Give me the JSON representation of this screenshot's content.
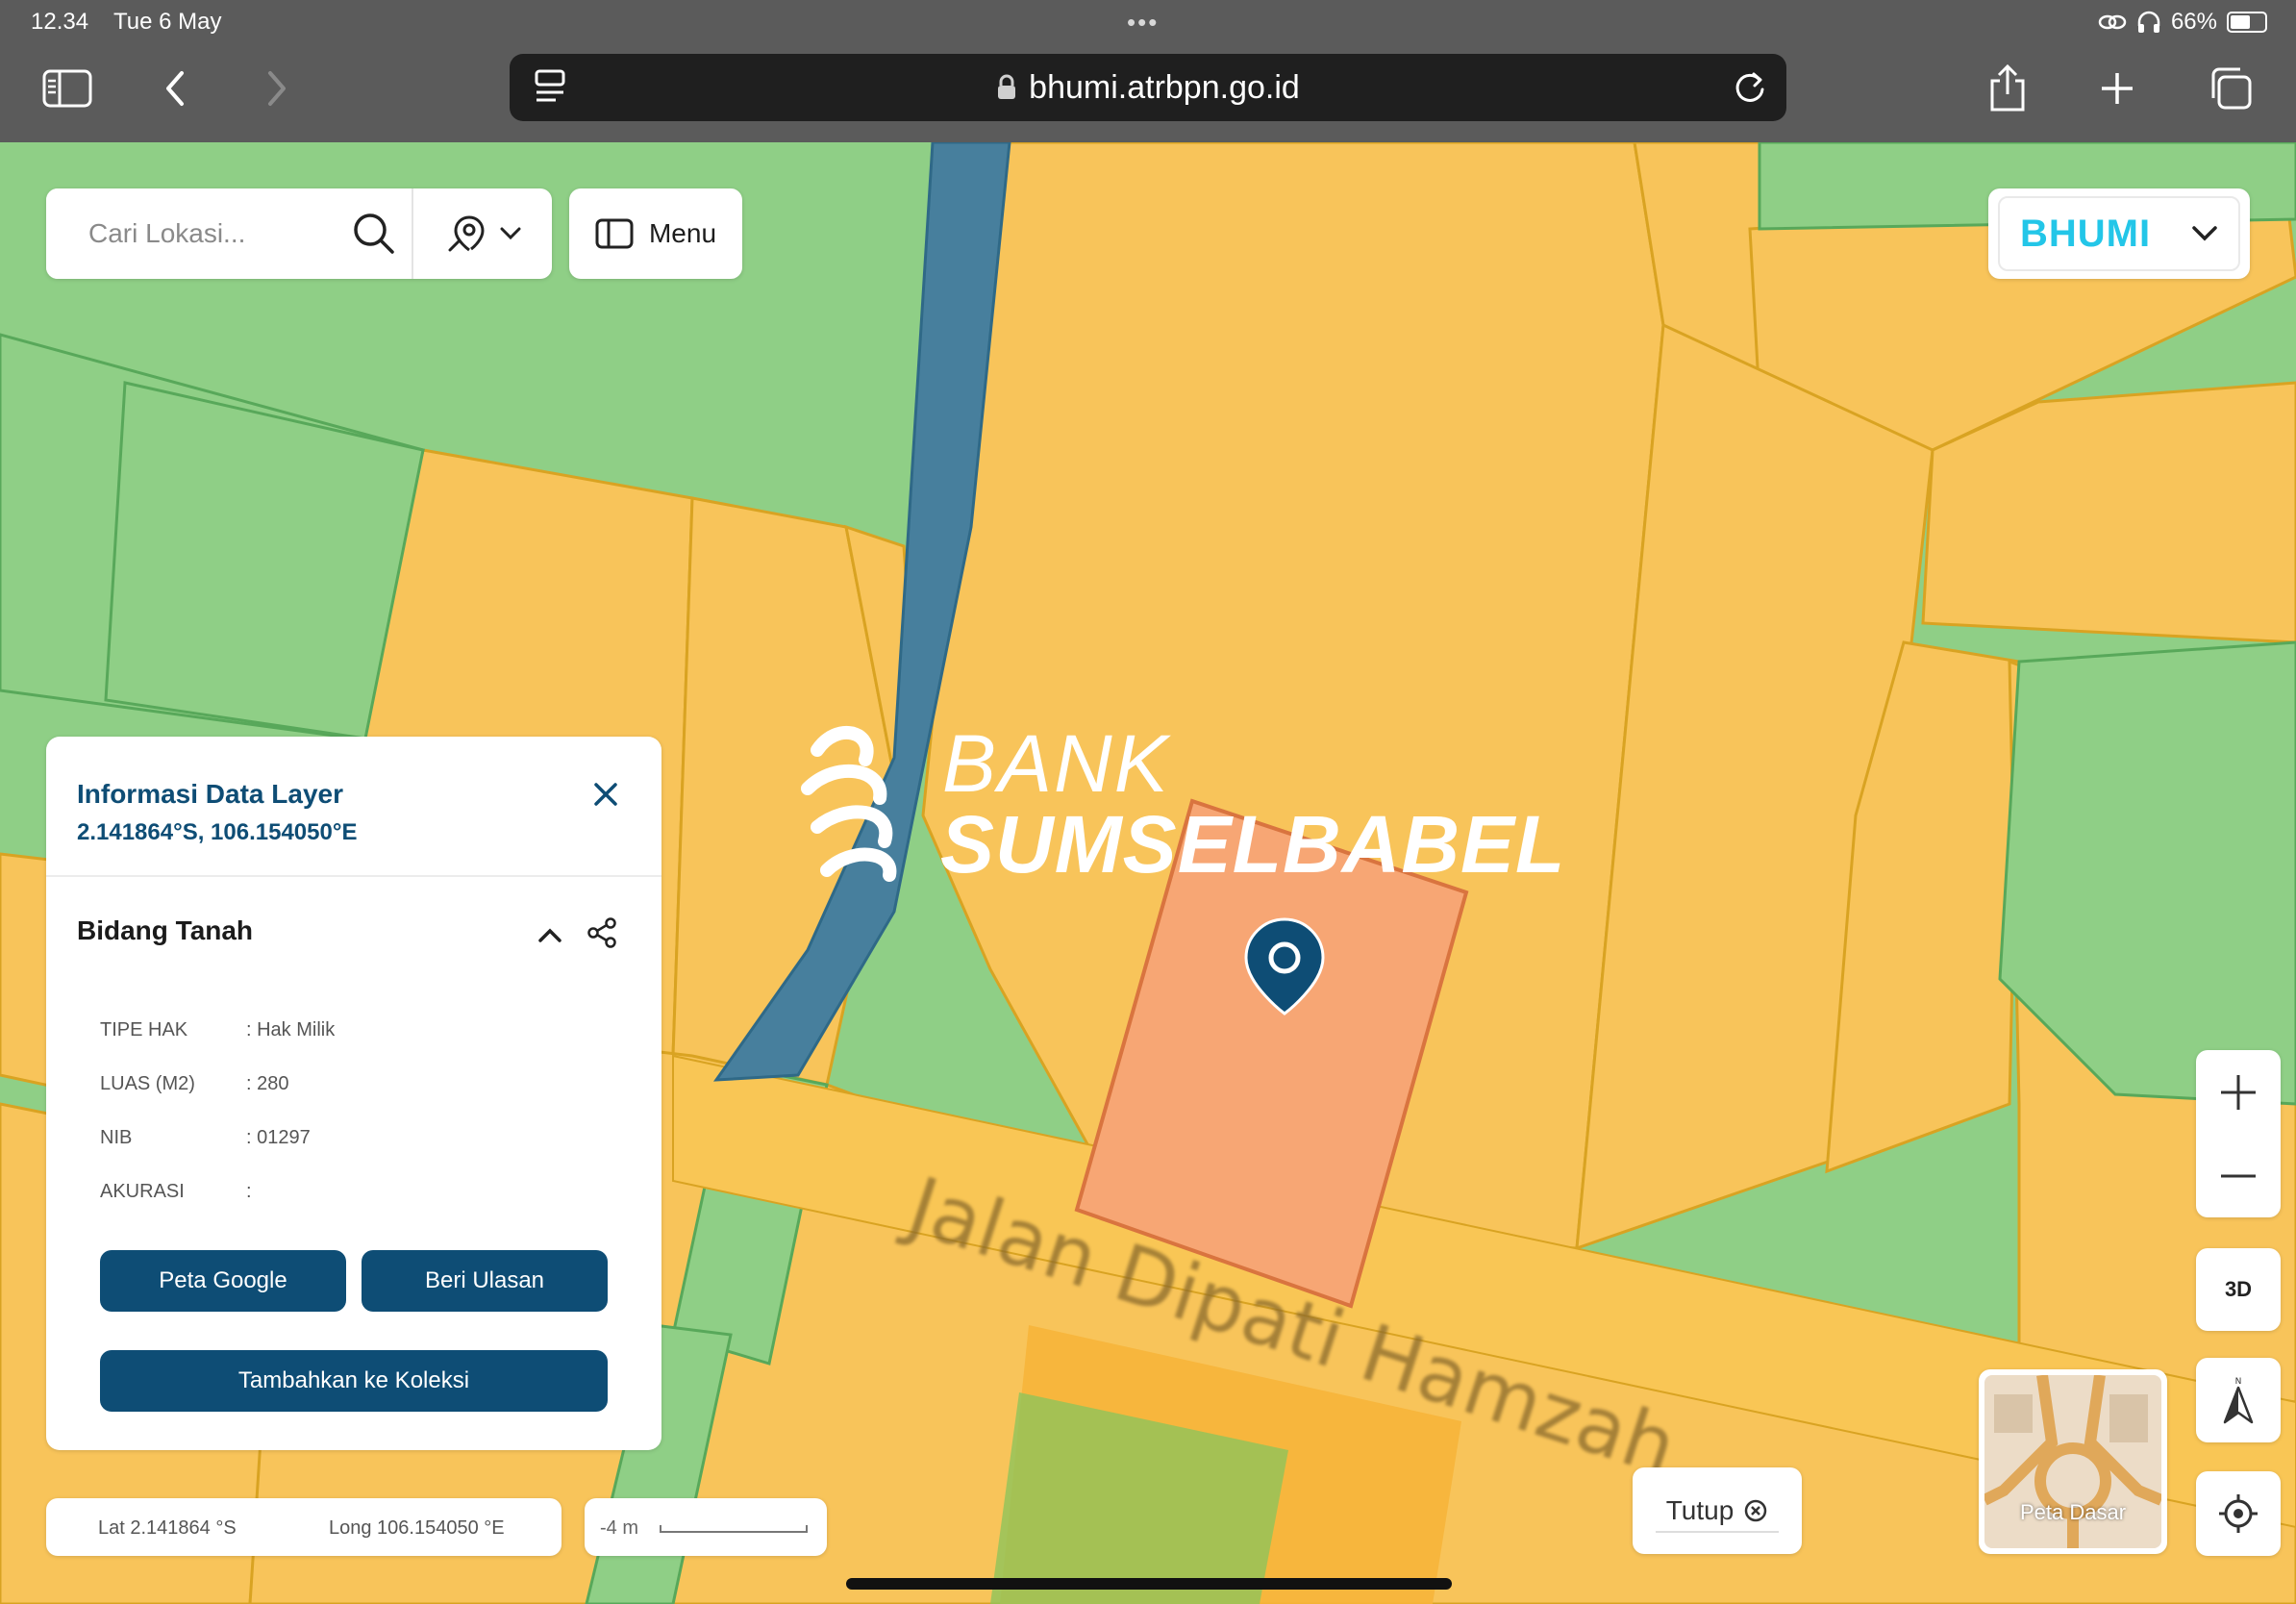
{
  "status_bar": {
    "time": "12.34",
    "date": "Tue 6 May",
    "battery": "66%",
    "battery_level": 0.66
  },
  "browser": {
    "url": "bhumi.atrbpn.go.id"
  },
  "search": {
    "placeholder": "Cari Lokasi..."
  },
  "toolbar": {
    "menu_label": "Menu",
    "brand": "BHUMI"
  },
  "map": {
    "street_label": "Jalan Dipati Hamzah",
    "watermark_line1": "BANK",
    "watermark_line2": "SUMSELBABEL"
  },
  "info_panel": {
    "title": "Informasi Data Layer",
    "coords": "2.141864°S, 106.154050°E",
    "section_title": "Bidang Tanah",
    "attributes": [
      {
        "key": "TIPE HAK",
        "value": ": Hak Milik"
      },
      {
        "key": "LUAS (M2)",
        "value": ": 280"
      },
      {
        "key": "NIB",
        "value": ": 01297"
      },
      {
        "key": "AKURASI",
        "value": ":"
      }
    ],
    "buttons": {
      "google": "Peta Google",
      "review": "Beri Ulasan",
      "collection": "Tambahkan ke Koleksi"
    }
  },
  "coord_bar": {
    "lat": "Lat 2.141864 °S",
    "long": "Long 106.154050 °E"
  },
  "scale": {
    "label": "-4 m"
  },
  "controls": {
    "tutup": "Tutup",
    "btn_3d": "3D",
    "basemap_label": "Peta Dasar"
  },
  "colors": {
    "parcel_orange": "#f8c45a",
    "parcel_green": "#8fcf86",
    "selected_parcel": "#f7a674",
    "river": "#477f9d",
    "accent": "#0e4d75",
    "brand": "#23c6e8"
  }
}
